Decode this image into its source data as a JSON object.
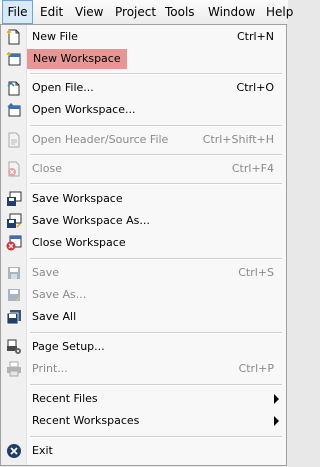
{
  "menubar": {
    "items": [
      {
        "label": "File"
      },
      {
        "label": "Edit"
      },
      {
        "label": "View"
      },
      {
        "label": "Project"
      },
      {
        "label": "Tools"
      },
      {
        "label": "Window"
      },
      {
        "label": "Help"
      }
    ]
  },
  "file_menu": {
    "new_file": {
      "label": "New File",
      "shortcut": "Ctrl+N"
    },
    "new_workspace": {
      "label": "New Workspace",
      "highlight_color": "#e89595"
    },
    "open_file": {
      "label": "Open File...",
      "shortcut": "Ctrl+O"
    },
    "open_workspace": {
      "label": "Open Workspace..."
    },
    "open_header_source": {
      "label": "Open Header/Source File",
      "shortcut": "Ctrl+Shift+H"
    },
    "close": {
      "label": "Close",
      "shortcut": "Ctrl+F4"
    },
    "save_workspace": {
      "label": "Save Workspace"
    },
    "save_workspace_as": {
      "label": "Save Workspace As..."
    },
    "close_workspace": {
      "label": "Close Workspace"
    },
    "save": {
      "label": "Save",
      "shortcut": "Ctrl+S"
    },
    "save_as": {
      "label": "Save As..."
    },
    "save_all": {
      "label": "Save All"
    },
    "page_setup": {
      "label": "Page Setup..."
    },
    "print": {
      "label": "Print...",
      "shortcut": "Ctrl+P"
    },
    "recent_files": {
      "label": "Recent Files"
    },
    "recent_workspaces": {
      "label": "Recent Workspaces"
    },
    "exit": {
      "label": "Exit"
    }
  }
}
